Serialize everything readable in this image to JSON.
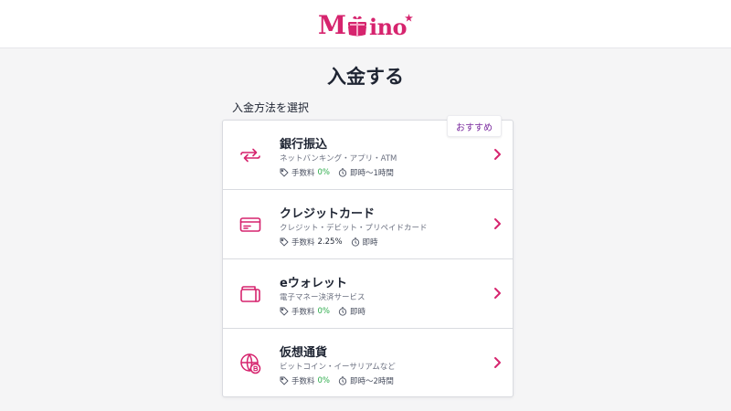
{
  "header": {
    "logo_text_m": "M",
    "logo_text_rest": "ino",
    "logo_star": "★"
  },
  "page": {
    "title": "入金する",
    "section_label": "入金方法を選択"
  },
  "badge": {
    "label": "おすすめ"
  },
  "methods": [
    {
      "name": "銀行振込",
      "desc": "ネットバンキング・アプリ・ATM",
      "fee_label": "手数料",
      "fee_value": "0%",
      "time": "即時〜1時間",
      "icon": "transfer-arrows-icon"
    },
    {
      "name": "クレジットカード",
      "desc": "クレジット・デビット・プリペイドカード",
      "fee_label": "手数料",
      "fee_value": "2.25%",
      "time": "即時",
      "icon": "credit-card-icon"
    },
    {
      "name": "eウォレット",
      "desc": "電子マネー決済サービス",
      "fee_label": "手数料",
      "fee_value": "0%",
      "time": "即時",
      "icon": "wallet-icon"
    },
    {
      "name": "仮想通貨",
      "desc": "ビットコイン・イーサリアムなど",
      "fee_label": "手数料",
      "fee_value": "0%",
      "time": "即時〜2時間",
      "icon": "crypto-globe-icon"
    }
  ],
  "colors": {
    "accent": "#d6246e",
    "fee_green": "#2bab4a",
    "badge_text": "#7a2a9e"
  }
}
